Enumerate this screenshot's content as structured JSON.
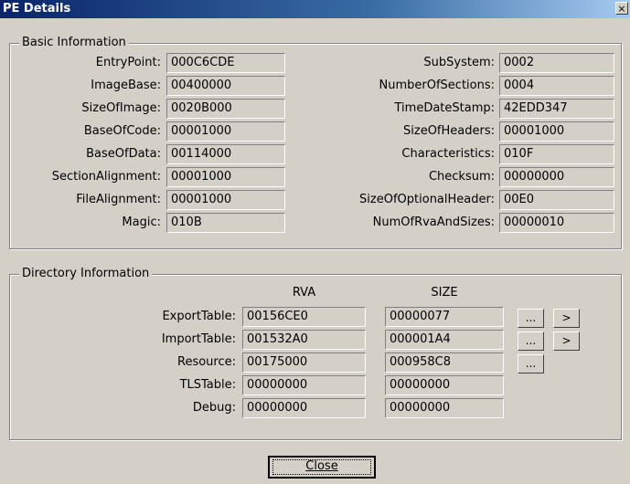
{
  "window": {
    "title": "PE Details",
    "close_glyph": "×"
  },
  "basic": {
    "legend": "Basic Information",
    "left": [
      {
        "label": "EntryPoint:",
        "value": "000C6CDE"
      },
      {
        "label": "ImageBase:",
        "value": "00400000"
      },
      {
        "label": "SizeOfImage:",
        "value": "0020B000"
      },
      {
        "label": "BaseOfCode:",
        "value": "00001000"
      },
      {
        "label": "BaseOfData:",
        "value": "00114000"
      },
      {
        "label": "SectionAlignment:",
        "value": "00001000"
      },
      {
        "label": "FileAlignment:",
        "value": "00001000"
      },
      {
        "label": "Magic:",
        "value": "010B"
      }
    ],
    "right": [
      {
        "label": "SubSystem:",
        "value": "0002"
      },
      {
        "label": "NumberOfSections:",
        "value": "0004"
      },
      {
        "label": "TimeDateStamp:",
        "value": "42EDD347"
      },
      {
        "label": "SizeOfHeaders:",
        "value": "00001000"
      },
      {
        "label": "Characteristics:",
        "value": "010F"
      },
      {
        "label": "Checksum:",
        "value": "00000000"
      },
      {
        "label": "SizeOfOptionalHeader:",
        "value": "00E0"
      },
      {
        "label": "NumOfRvaAndSizes:",
        "value": "00000010"
      }
    ]
  },
  "directory": {
    "legend": "Directory Information",
    "col_rva": "RVA",
    "col_size": "SIZE",
    "rows": [
      {
        "label": "ExportTable:",
        "rva": "00156CE0",
        "size": "00000077",
        "more": "...",
        "go": ">"
      },
      {
        "label": "ImportTable:",
        "rva": "001532A0",
        "size": "000001A4",
        "more": "...",
        "go": ">"
      },
      {
        "label": "Resource:",
        "rva": "00175000",
        "size": "000958C8",
        "more": "..."
      },
      {
        "label": "TLSTable:",
        "rva": "00000000",
        "size": "00000000"
      },
      {
        "label": "Debug:",
        "rva": "00000000",
        "size": "00000000"
      }
    ]
  },
  "footer": {
    "close_label": "Close"
  }
}
